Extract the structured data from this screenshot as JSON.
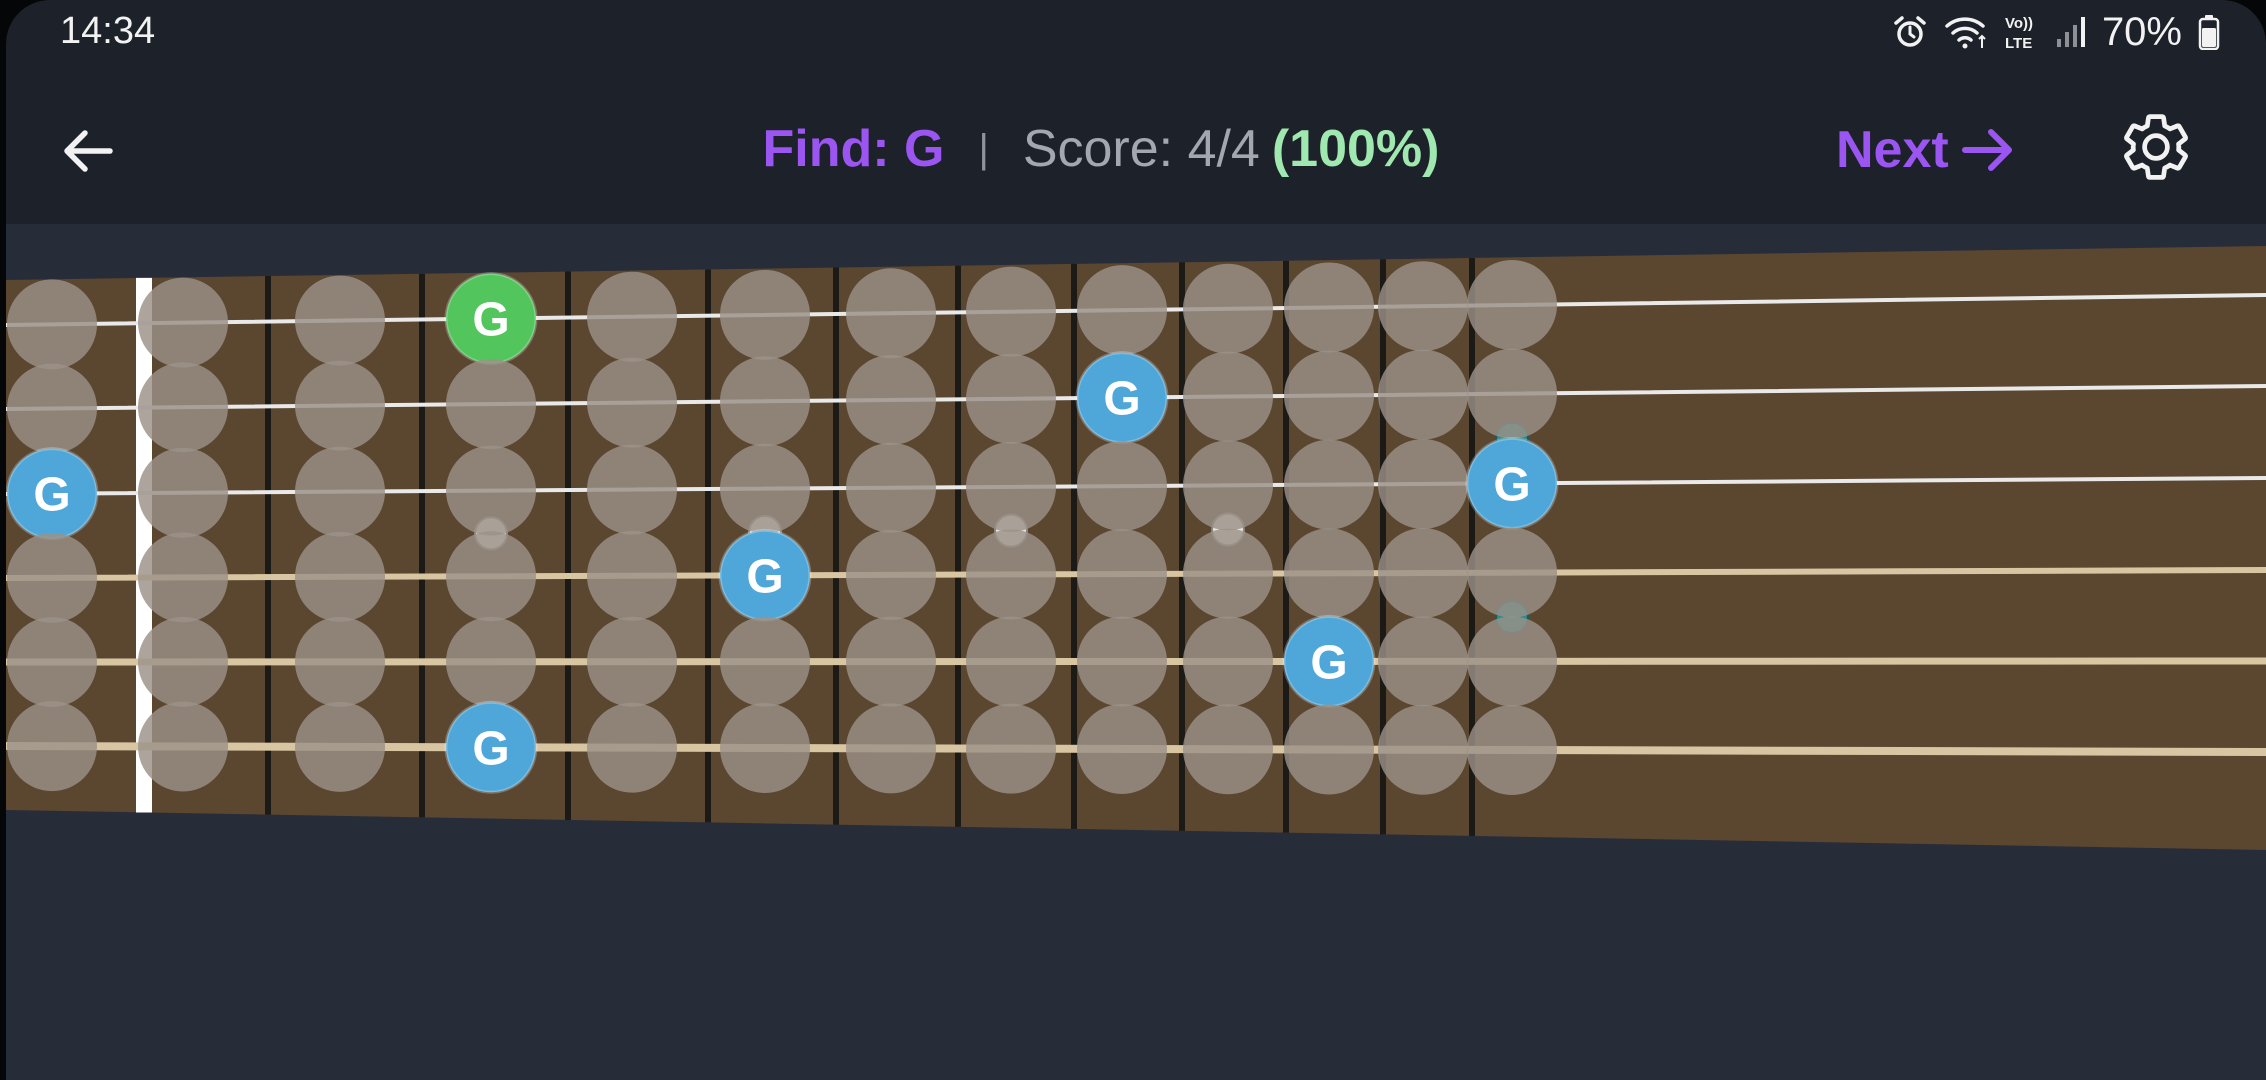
{
  "status_bar": {
    "time": "14:34",
    "battery": "70%",
    "icons": [
      "alarm-icon",
      "wifi-icon",
      "volte-icon",
      "signal-icon",
      "battery-icon"
    ],
    "volte_label_top": "Vo))",
    "volte_label_bottom": "LTE"
  },
  "header": {
    "find_label": "Find: G",
    "separator": "|",
    "score_label": "Score: 4/4",
    "score_percent": "(100%)",
    "next_label": "Next",
    "back_icon": "arrow-left-icon",
    "next_icon": "arrow-right-icon",
    "settings_icon": "gear-icon"
  },
  "colors": {
    "accent": "#9b55f0",
    "score_green": "#9fe8b0",
    "fretboard_wood": "#5b4630",
    "note_default": "#9b9187",
    "note_found": "#4ea7d8",
    "note_selected": "#52c65c",
    "background": "#1d2129",
    "content_bg": "#272c39"
  },
  "fretboard": {
    "strings": 6,
    "positions": 13,
    "inlay_dots_single_frets": [
      3,
      5,
      7,
      9
    ],
    "inlay_dots_double_fret": 12,
    "highlighted_notes": [
      {
        "label": "G",
        "string": 1,
        "fret": 3,
        "state": "selected"
      },
      {
        "label": "G",
        "string": 2,
        "fret": 8,
        "state": "found"
      },
      {
        "label": "G",
        "string": 3,
        "fret": 0,
        "state": "found"
      },
      {
        "label": "G",
        "string": 3,
        "fret": 12,
        "state": "found"
      },
      {
        "label": "G",
        "string": 4,
        "fret": 5,
        "state": "found"
      },
      {
        "label": "G",
        "string": 5,
        "fret": 10,
        "state": "found"
      },
      {
        "label": "G",
        "string": 6,
        "fret": 3,
        "state": "found"
      }
    ]
  }
}
